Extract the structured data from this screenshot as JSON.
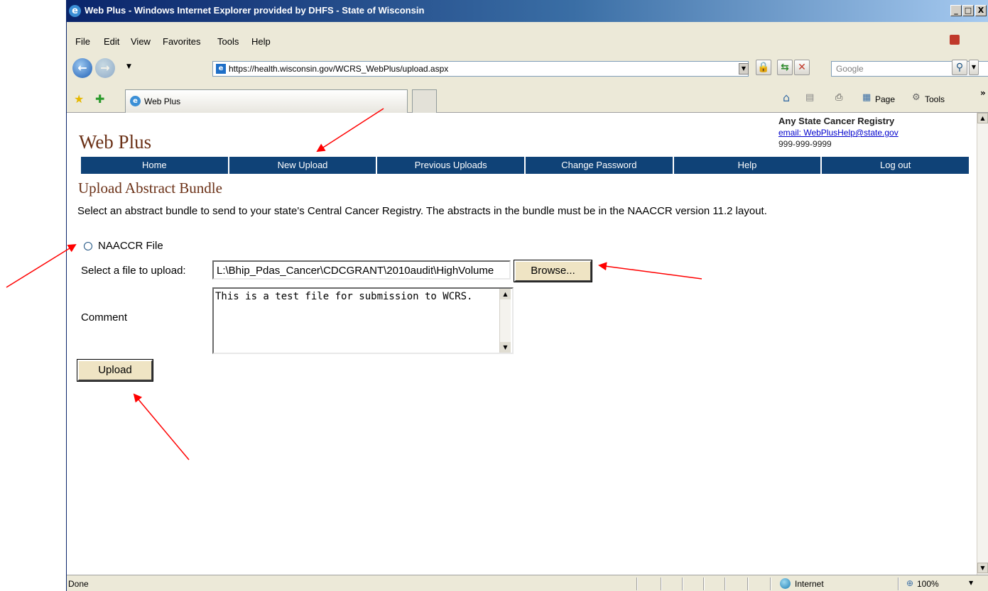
{
  "window": {
    "title": "Web Plus - Windows Internet Explorer provided by DHFS - State of Wisconsin",
    "minimize_glyph": "_",
    "maximize_glyph": "□",
    "close_glyph": "X"
  },
  "menubar": {
    "items": [
      {
        "label": "File"
      },
      {
        "label": "Edit"
      },
      {
        "label": "View"
      },
      {
        "label": "Favorites"
      },
      {
        "label": "Tools"
      },
      {
        "label": "Help"
      }
    ]
  },
  "address_bar": {
    "url": "https://health.wisconsin.gov/WCRS_WebPlus/upload.aspx",
    "search_placeholder": "Google"
  },
  "tab": {
    "label": "Web Plus"
  },
  "command_bar": {
    "page_label": "Page",
    "tools_label": "Tools"
  },
  "page": {
    "brand": "Web Plus",
    "org_name": "Any State Cancer Registry",
    "org_email": "email: WebPlusHelp@state.gov",
    "org_phone": "999-999-9999",
    "nav": [
      {
        "label": "Home"
      },
      {
        "label": "New Upload"
      },
      {
        "label": "Previous Uploads"
      },
      {
        "label": "Change Password"
      },
      {
        "label": "Help"
      },
      {
        "label": "Log out"
      }
    ],
    "title": "Upload Abstract Bundle",
    "intro": "Select an abstract bundle to send to your state's Central Cancer Registry. The abstracts in the bundle must be in the NAACCR version 11.2 layout.",
    "radio_label": "NAACCR File",
    "radio_selected": false,
    "file_label": "Select a file to upload:",
    "file_value": "L:\\Bhip_Pdas_Cancer\\CDCGRANT\\2010audit\\HighVolume",
    "browse_label": "Browse...",
    "comment_label": "Comment",
    "comment_value": "This is a test file for submission to WCRS.",
    "upload_label": "Upload"
  },
  "statusbar": {
    "status": "Done",
    "zone": "Internet",
    "zoom": "100%"
  },
  "colors": {
    "nav_bg": "#0f4277",
    "brand": "#6b3117",
    "button_bg": "#efe4c4",
    "annotation_arrow": "#ff0000"
  }
}
